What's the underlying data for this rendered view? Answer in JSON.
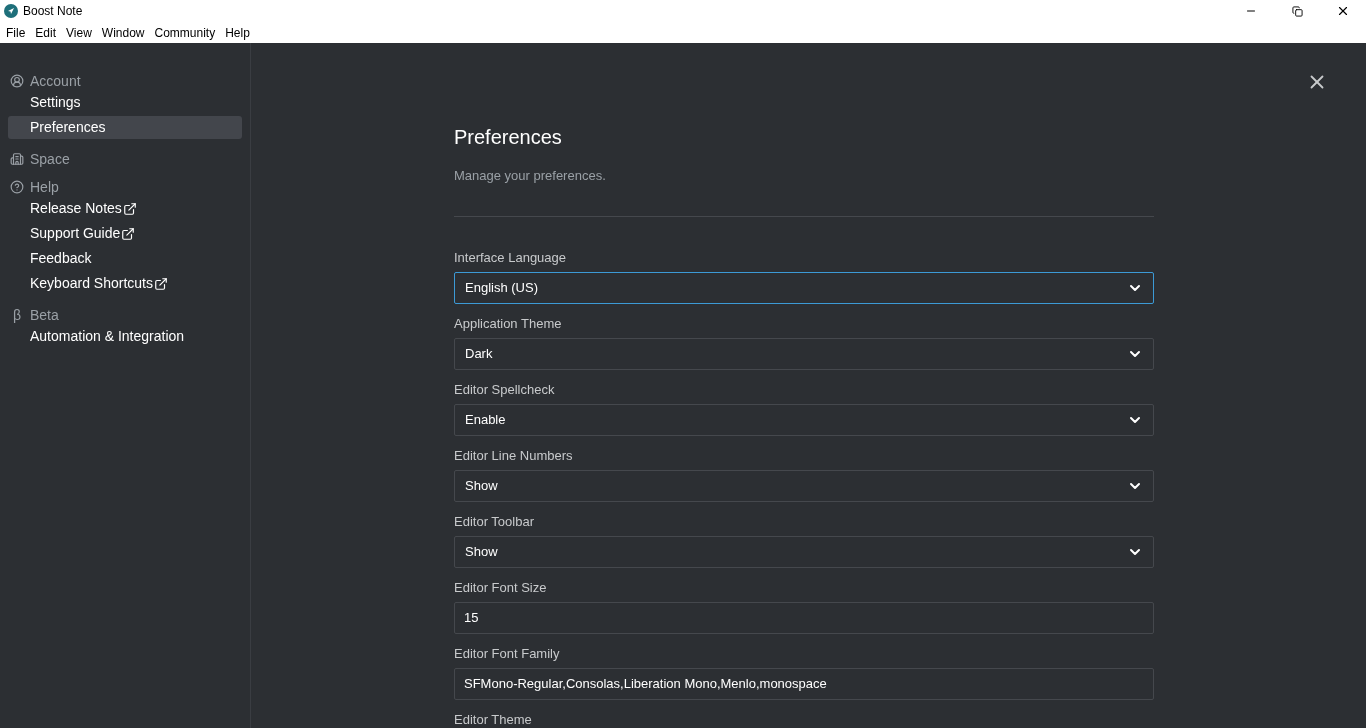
{
  "window": {
    "title": "Boost Note"
  },
  "menu": [
    "File",
    "Edit",
    "View",
    "Window",
    "Community",
    "Help"
  ],
  "sidebar": {
    "sections": [
      {
        "kind": "account",
        "label": "Account",
        "items": [
          {
            "label": "Settings",
            "selected": false,
            "external": false
          },
          {
            "label": "Preferences",
            "selected": true,
            "external": false
          }
        ]
      },
      {
        "kind": "space",
        "label": "Space"
      },
      {
        "kind": "help",
        "label": "Help",
        "items": [
          {
            "label": "Release Notes",
            "selected": false,
            "external": true
          },
          {
            "label": "Support Guide",
            "selected": false,
            "external": true
          },
          {
            "label": "Feedback",
            "selected": false,
            "external": false
          },
          {
            "label": "Keyboard Shortcuts",
            "selected": false,
            "external": true
          }
        ]
      },
      {
        "kind": "beta",
        "label": "Beta",
        "glyph": "β",
        "items": [
          {
            "label": "Automation & Integration",
            "selected": false,
            "external": false
          }
        ]
      }
    ]
  },
  "page": {
    "title": "Preferences",
    "subtitle": "Manage your preferences.",
    "fields": [
      {
        "kind": "select",
        "label": "Interface Language",
        "value": "English (US)",
        "focused": true
      },
      {
        "kind": "select",
        "label": "Application Theme",
        "value": "Dark",
        "focused": false
      },
      {
        "kind": "select",
        "label": "Editor Spellcheck",
        "value": "Enable",
        "focused": false
      },
      {
        "kind": "select",
        "label": "Editor Line Numbers",
        "value": "Show",
        "focused": false
      },
      {
        "kind": "select",
        "label": "Editor Toolbar",
        "value": "Show",
        "focused": false
      },
      {
        "kind": "text",
        "label": "Editor Font Size",
        "value": "15",
        "focused": false
      },
      {
        "kind": "text",
        "label": "Editor Font Family",
        "value": "SFMono-Regular,Consolas,Liberation Mono,Menlo,monospace",
        "focused": false
      }
    ],
    "trailing_label": "Editor Theme"
  }
}
